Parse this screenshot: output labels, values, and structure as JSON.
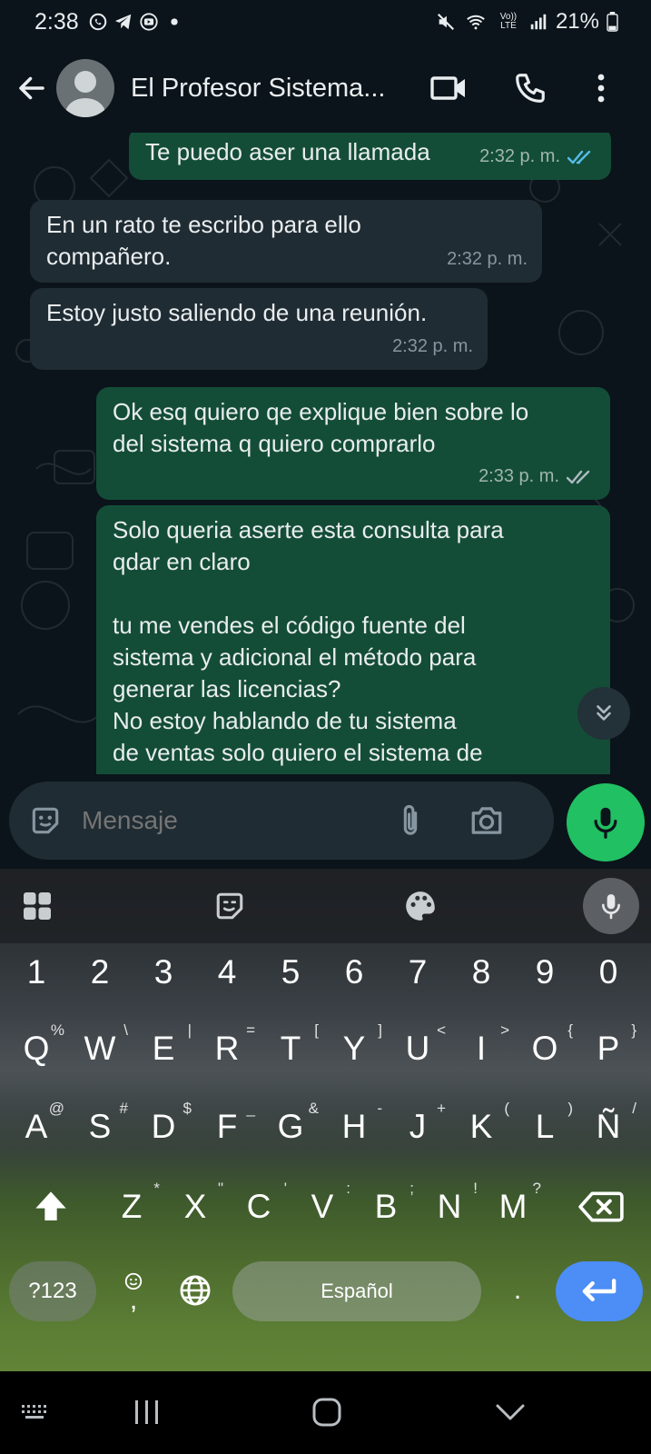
{
  "status_bar": {
    "time": "2:38",
    "battery_percent": "21%",
    "volte": "Vo)) LTE",
    "icons": [
      "whatsapp-notification-icon",
      "telegram-icon",
      "youtube-icon",
      "dot-icon",
      "mute-icon",
      "wifi-icon",
      "volte-icon",
      "signal-icon",
      "battery-icon"
    ]
  },
  "header": {
    "contact_name": "El Profesor Sistema...",
    "icons": [
      "back-arrow-icon",
      "avatar-placeholder",
      "video-call-icon",
      "phone-call-icon",
      "more-vertical-icon"
    ]
  },
  "messages": [
    {
      "direction": "out",
      "text": "Te puedo aser una llamada",
      "time": "2:32 p. m.",
      "ticks": "read"
    },
    {
      "direction": "in",
      "text": "En un rato te escribo para ello\ncompañero.",
      "time": "2:32 p. m."
    },
    {
      "direction": "in",
      "text": "Estoy justo saliendo de una reunión.",
      "time": "2:32 p. m."
    },
    {
      "direction": "out",
      "text": "Ok esq quiero qe explique bien sobre lo\ndel sistema q quiero comprarlo",
      "time": "2:33 p. m.",
      "ticks": "delivered"
    },
    {
      "direction": "out",
      "text": "Solo queria aserte esta consulta para\nqdar en claro\n\ntu me vendes el código fuente del\nsistema y adicional el método para\ngenerar las licencias?\nNo estoy hablando de tu sistema\nde ventas solo quiero el sistema de",
      "time": ""
    }
  ],
  "composer": {
    "placeholder": "Mensaje"
  },
  "keyboard": {
    "number_row": [
      "1",
      "2",
      "3",
      "4",
      "5",
      "6",
      "7",
      "8",
      "9",
      "0"
    ],
    "row1": [
      {
        "k": "Q",
        "s": "%"
      },
      {
        "k": "W",
        "s": "\\"
      },
      {
        "k": "E",
        "s": "|"
      },
      {
        "k": "R",
        "s": "="
      },
      {
        "k": "T",
        "s": "["
      },
      {
        "k": "Y",
        "s": "]"
      },
      {
        "k": "U",
        "s": "<"
      },
      {
        "k": "I",
        "s": ">"
      },
      {
        "k": "O",
        "s": "{"
      },
      {
        "k": "P",
        "s": "}"
      }
    ],
    "row2": [
      {
        "k": "A",
        "s": "@"
      },
      {
        "k": "S",
        "s": "#"
      },
      {
        "k": "D",
        "s": "$"
      },
      {
        "k": "F",
        "s": "_"
      },
      {
        "k": "G",
        "s": "&"
      },
      {
        "k": "H",
        "s": "-"
      },
      {
        "k": "J",
        "s": "+"
      },
      {
        "k": "K",
        "s": "("
      },
      {
        "k": "L",
        "s": ")"
      },
      {
        "k": "Ñ",
        "s": "/"
      }
    ],
    "row3": [
      {
        "k": "Z",
        "s": "*"
      },
      {
        "k": "X",
        "s": "\""
      },
      {
        "k": "C",
        "s": "'"
      },
      {
        "k": "V",
        "s": ":"
      },
      {
        "k": "B",
        "s": ";"
      },
      {
        "k": "N",
        "s": "!"
      },
      {
        "k": "M",
        "s": "?"
      }
    ],
    "symbols_label": "?123",
    "comma_label": ",",
    "space_label": "Español",
    "period_label": "."
  },
  "colors": {
    "background": "#0b141a",
    "incoming_bubble": "#202c33",
    "outgoing_bubble": "#144d37",
    "read_ticks": "#53bdeb",
    "mic_button": "#21c063",
    "enter_key": "#4c8df6"
  }
}
